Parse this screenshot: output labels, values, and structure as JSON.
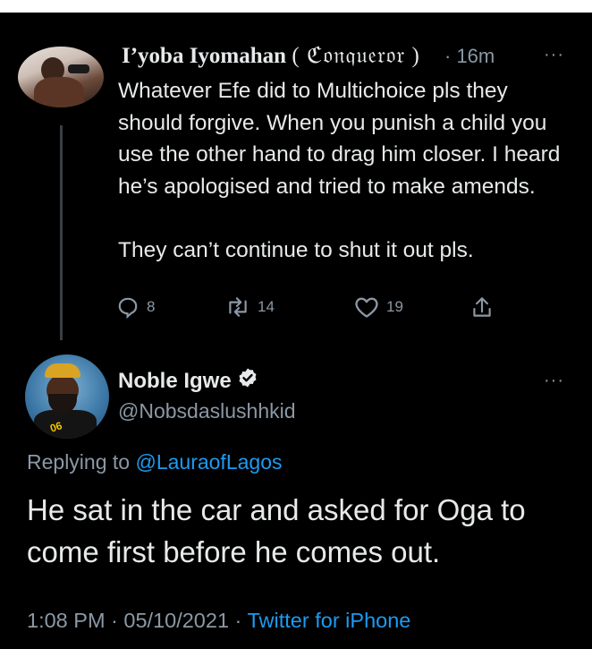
{
  "parent_tweet": {
    "author_name": "I’yoba Iyomahan",
    "name_decoration": "( ℭ𝔬𝔫𝔮𝔲𝔢𝔯𝔬𝔯 )",
    "time_ago": "· 16m",
    "more_label": "···",
    "text": "Whatever Efe did to Multichoice pls they should forgive. When you punish a child you use the other hand to drag him closer. I heard he’s apologised and tried to make amends.\n\nThey can’t continue to shut it out pls.",
    "actions": {
      "replies": "8",
      "retweets": "14",
      "likes": "19"
    },
    "icons": [
      "reply-icon",
      "retweet-icon",
      "like-icon",
      "share-icon"
    ]
  },
  "main_tweet": {
    "author_name": "Noble Igwe",
    "handle": "@Nobsdaslushhkid",
    "more_label": "···",
    "replying_prefix": "Replying to",
    "replying_to": "@LauraofLagos",
    "text": "He sat in the car and asked for Oga to come first before he comes out.",
    "timestamp": "1:08 PM · 05/10/2021 ·",
    "source": "Twitter for iPhone",
    "verified_icon": "verified-badge-icon"
  },
  "colors": {
    "background": "#000000",
    "text": "#e7e9ea",
    "muted": "#8b98a5",
    "link": "#1d9bf0",
    "thread_line": "#3b3f44"
  }
}
